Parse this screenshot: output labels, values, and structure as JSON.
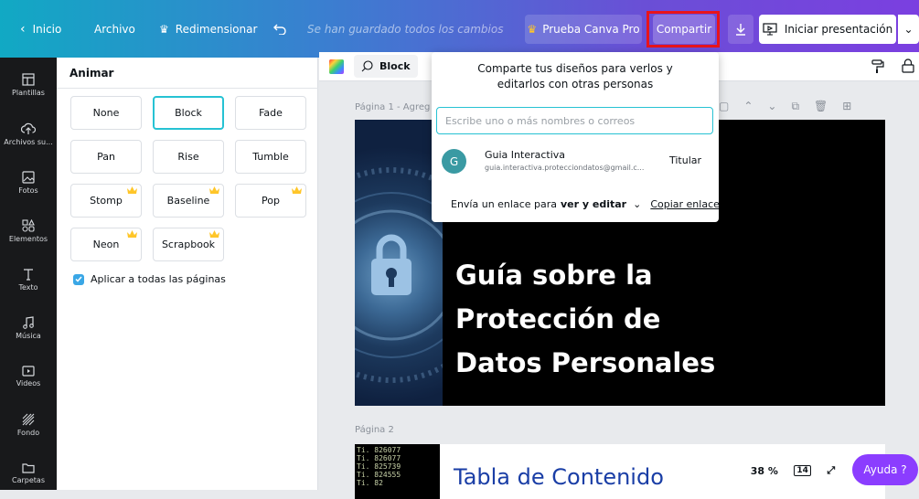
{
  "topbar": {
    "home": "Inicio",
    "file": "Archivo",
    "resize": "Redimensionar",
    "saved_status": "Se han guardado todos los cambios",
    "try_pro": "Prueba Canva Pro",
    "share": "Compartir",
    "present": "Iniciar presentación"
  },
  "sidebar": {
    "items": [
      {
        "label": "Plantillas",
        "icon": "templates-icon"
      },
      {
        "label": "Archivos su...",
        "icon": "upload-icon"
      },
      {
        "label": "Fotos",
        "icon": "photos-icon"
      },
      {
        "label": "Elementos",
        "icon": "elements-icon"
      },
      {
        "label": "Texto",
        "icon": "text-icon"
      },
      {
        "label": "Música",
        "icon": "music-icon"
      },
      {
        "label": "Videos",
        "icon": "videos-icon"
      },
      {
        "label": "Fondo",
        "icon": "background-icon"
      },
      {
        "label": "Carpetas",
        "icon": "folder-icon"
      }
    ]
  },
  "panel": {
    "title": "Animar",
    "animations": [
      {
        "label": "None",
        "pro": false,
        "selected": false
      },
      {
        "label": "Block",
        "pro": false,
        "selected": true
      },
      {
        "label": "Fade",
        "pro": false,
        "selected": false
      },
      {
        "label": "Pan",
        "pro": false,
        "selected": false
      },
      {
        "label": "Rise",
        "pro": false,
        "selected": false
      },
      {
        "label": "Tumble",
        "pro": false,
        "selected": false
      },
      {
        "label": "Stomp",
        "pro": true,
        "selected": false
      },
      {
        "label": "Baseline",
        "pro": true,
        "selected": false
      },
      {
        "label": "Pop",
        "pro": true,
        "selected": false
      },
      {
        "label": "Neon",
        "pro": true,
        "selected": false
      },
      {
        "label": "Scrapbook",
        "pro": true,
        "selected": false
      }
    ],
    "apply_all": "Aplicar a todas las páginas"
  },
  "toolbar": {
    "anim_label": "Block"
  },
  "canvas": {
    "page1_label": "Página 1 - Agreg",
    "page1_title": [
      "Guía sobre la",
      "Protección de",
      "Datos Personales"
    ],
    "page2_label": "Página 2",
    "page2_title": "Tabla de Contenido",
    "page2_code": [
      "Ti. 826077",
      "Ti. 826077",
      "Ti. 825739",
      "Ti. 824555",
      "Ti. 82"
    ]
  },
  "share": {
    "heading": "Comparte tus diseños para verlos y editarlos con otras personas",
    "placeholder": "Escribe uno o más nombres o correos",
    "avatar_initial": "G",
    "name": "Guia Interactiva",
    "email": "guia.interactiva.protecciondatos@gmail.c...",
    "role": "Titular",
    "link_prefix": "Envía un enlace para",
    "link_mode": "ver y editar",
    "copy_link": "Copiar enlace"
  },
  "bottom": {
    "zoom": "38 %",
    "pages": "14",
    "help": "Ayuda ?"
  },
  "colors": {
    "accent": "#8b3dff",
    "selection": "#26c2d3",
    "highlight": "#e8141c"
  }
}
